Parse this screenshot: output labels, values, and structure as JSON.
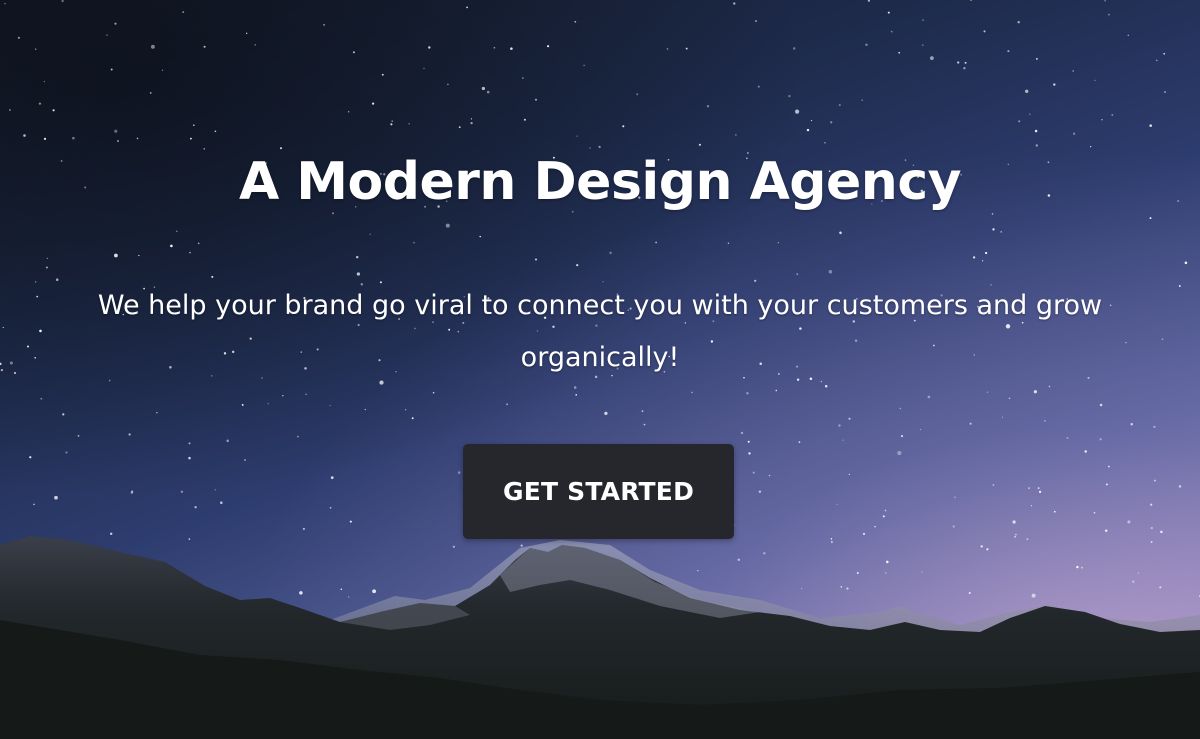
{
  "hero": {
    "title": "A Modern Design Agency",
    "subtitle": "We help your brand go viral to connect you with your customers and grow organically!",
    "cta_label": "GET STARTED"
  },
  "background": {
    "scene": "starry-night-sky-over-mountains",
    "colors": {
      "sky_top": "#151b2a",
      "sky_mid": "#2d3c6e",
      "sky_horizon": "#a592c0",
      "mountain": "#1b1f1f",
      "snow": "#8e92a6",
      "button": "#26272c",
      "text": "#ffffff"
    }
  }
}
